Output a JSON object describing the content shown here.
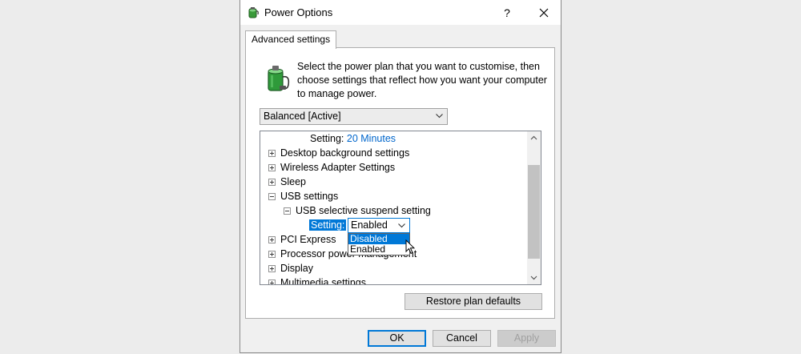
{
  "window": {
    "title": "Power Options",
    "help_label": "?",
    "close_label": "✕"
  },
  "tab": {
    "label": "Advanced settings"
  },
  "intro_text": "Select the power plan that you want to customise, then choose settings that reflect how you want your computer to manage power.",
  "plan_select": {
    "value": "Balanced [Active]"
  },
  "tree": {
    "top_setting": {
      "label": "Setting:",
      "value": "20 Minutes"
    },
    "items": [
      {
        "label": "Desktop background settings"
      },
      {
        "label": "Wireless Adapter Settings"
      },
      {
        "label": "Sleep"
      },
      {
        "label": "USB settings"
      },
      {
        "label": "USB selective suspend setting"
      },
      {
        "label": "PCI Express"
      },
      {
        "label": "Processor power management"
      },
      {
        "label": "Display"
      },
      {
        "label": "Multimedia settings"
      }
    ],
    "usb_setting": {
      "label": "Setting:",
      "value": "Enabled",
      "options": [
        "Disabled",
        "Enabled"
      ],
      "highlighted_option": "Disabled"
    }
  },
  "buttons": {
    "restore": "Restore plan defaults",
    "ok": "OK",
    "cancel": "Cancel",
    "apply": "Apply"
  },
  "colors": {
    "accent": "#0078d7",
    "link_blue": "#0066cc"
  },
  "icons": {
    "app": "power-plan-battery-icon",
    "plan": "power-plan-battery-icon"
  }
}
